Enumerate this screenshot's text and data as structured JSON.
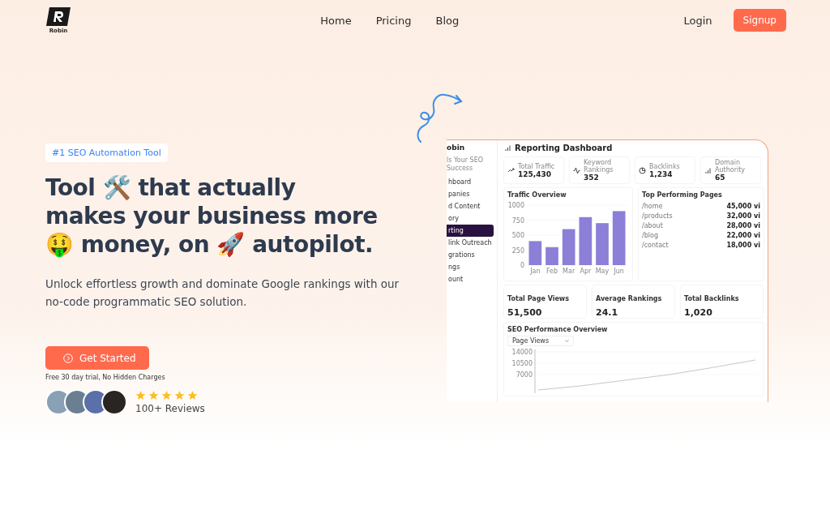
{
  "header": {
    "logo_text": "Robin",
    "nav": [
      {
        "label": "Home"
      },
      {
        "label": "Pricing"
      },
      {
        "label": "Blog"
      }
    ],
    "login": "Login",
    "signup": "Signup"
  },
  "hero": {
    "badge": "#1 SEO Automation Tool",
    "headline": [
      "Tool 🛠️ that actually",
      "makes your business more",
      "🤑 money, on 🚀 autopilot."
    ],
    "subtitle": "Unlock effortless growth and dominate Google rankings with our no-code programmatic SEO solution.",
    "cta": "Get Started",
    "note": "Free 30 day trial, No Hidden Charges",
    "stars": 5,
    "reviews": "100+ Reviews"
  },
  "dashboard": {
    "title": "Reporting Dashboard",
    "logo_text": "obin",
    "sidebar_tagline": "ls Your SEO Success",
    "sidebar": [
      {
        "label": "hboard",
        "selected": false
      },
      {
        "label": "panies",
        "selected": false
      },
      {
        "label": "d Content",
        "selected": false
      },
      {
        "label": "ory",
        "selected": false
      },
      {
        "label": "rting",
        "selected": true
      },
      {
        "label": "link Outreach",
        "selected": false
      },
      {
        "label": "grations",
        "selected": false
      },
      {
        "label": "ngs",
        "selected": false
      },
      {
        "label": "ount",
        "selected": false
      }
    ],
    "stats": [
      {
        "kind": "trend",
        "label": "Total Traffic",
        "value": "125,430"
      },
      {
        "kind": "pulse",
        "label": "Keyword Rankings",
        "value": "352"
      },
      {
        "kind": "pie",
        "label": "Backlinks",
        "value": "1,234"
      },
      {
        "kind": "bars",
        "label": "Domain Authority",
        "value": "65"
      }
    ],
    "traffic": {
      "title": "Traffic Overview",
      "chart_data": {
        "type": "bar",
        "categories": [
          "Jan",
          "Feb",
          "Mar",
          "Apr",
          "May",
          "Jun"
        ],
        "values": [
          400,
          300,
          600,
          800,
          700,
          900
        ],
        "ylim": [
          0,
          1000
        ],
        "yticks": [
          0,
          250,
          500,
          750,
          1000
        ]
      }
    },
    "top_pages": {
      "title": "Top Performing Pages",
      "rows": [
        {
          "page": "/home",
          "views": "45,000 vi"
        },
        {
          "page": "/products",
          "views": "32,000 vi"
        },
        {
          "page": "/about",
          "views": "28,000 vi"
        },
        {
          "page": "/blog",
          "views": "22,000 vi"
        },
        {
          "page": "/contact",
          "views": "18,000 vi"
        }
      ]
    },
    "totals": [
      {
        "label": "Total Page Views",
        "value": "51,500"
      },
      {
        "label": "Average Rankings",
        "value": "24.1"
      },
      {
        "label": "Total Backlinks",
        "value": "1,020"
      }
    ],
    "seo": {
      "title": "SEO Performance Overview",
      "select": "Page Views",
      "axis_labels": [
        "14000",
        "10500",
        "7000"
      ]
    }
  }
}
